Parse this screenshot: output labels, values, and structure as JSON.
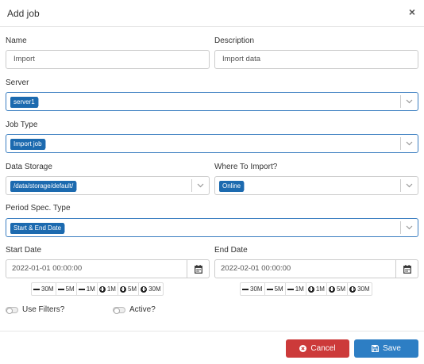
{
  "modal": {
    "title": "Add job",
    "close_symbol": "×"
  },
  "fields": {
    "name": {
      "label": "Name",
      "value": "Import"
    },
    "description": {
      "label": "Description",
      "value": "Import data"
    },
    "server": {
      "label": "Server",
      "selected": "server1"
    },
    "job_type": {
      "label": "Job Type",
      "selected": "Import job"
    },
    "data_storage": {
      "label": "Data Storage",
      "selected": "/data/storage/default/"
    },
    "where_to_import": {
      "label": "Where To Import?",
      "selected": "Online"
    },
    "period_spec_type": {
      "label": "Period Spec. Type",
      "selected": "Start & End Date"
    },
    "start_date": {
      "label": "Start Date",
      "value": "2022-01-01 00:00:00"
    },
    "end_date": {
      "label": "End Date",
      "value": "2022-02-01 00:00:00"
    }
  },
  "steppers": {
    "minus_30m": "30M",
    "minus_5m": "5M",
    "minus_1m": "1M",
    "plus_1m": "1M",
    "plus_5m": "5M",
    "plus_30m": "30M"
  },
  "toggles": {
    "use_filters": {
      "label": "Use Filters?",
      "on": false
    },
    "active": {
      "label": "Active?",
      "on": false
    }
  },
  "buttons": {
    "cancel": "Cancel",
    "save": "Save"
  },
  "icons": {
    "close": "close-icon",
    "dropdown": "chevron-down-icon",
    "calendar": "calendar-icon",
    "minus": "minus-icon",
    "plus": "plus-circle-icon",
    "cancel": "times-circle-icon",
    "save": "floppy-disk-icon"
  },
  "colors": {
    "tag": "#1c6aaf",
    "cancel": "#cc3a3a",
    "save": "#2d7ec4",
    "select_border": "#3c7fc1"
  }
}
